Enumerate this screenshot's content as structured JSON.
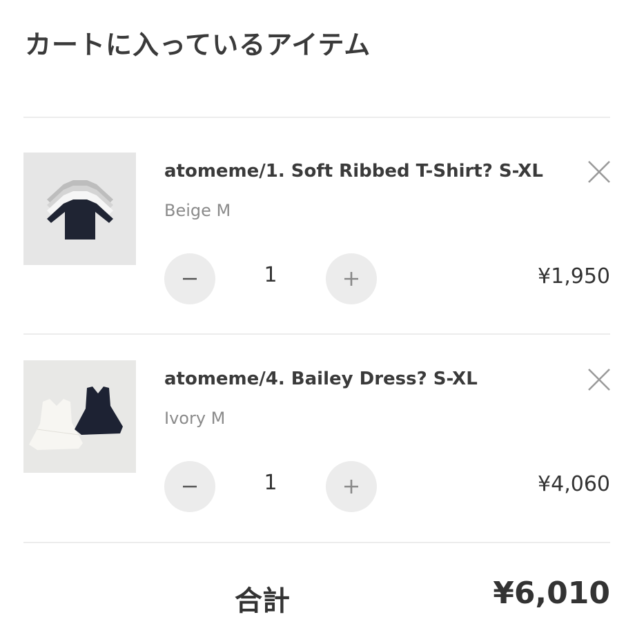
{
  "cart": {
    "title": "カートに入っているアイテム",
    "items": [
      {
        "name": "atomeme/1. Soft Ribbed T-Shirt? S-XL",
        "variant": "Beige M",
        "quantity": "1",
        "price": "¥1,950",
        "image": "stacked-long-sleeve-shirts"
      },
      {
        "name": "atomeme/4. Bailey Dress? S-XL",
        "variant": "Ivory M",
        "quantity": "1",
        "price": "¥4,060",
        "image": "ivory-and-navy-dresses"
      }
    ],
    "total_label": "合計",
    "total_value": "¥6,010"
  },
  "icons": {
    "remove": "close-icon",
    "decrease": "minus-icon",
    "increase": "plus-icon"
  },
  "colors": {
    "text": "#333333",
    "muted": "#8a8a8a",
    "button_bg": "#ececec",
    "divider": "#ececec"
  }
}
